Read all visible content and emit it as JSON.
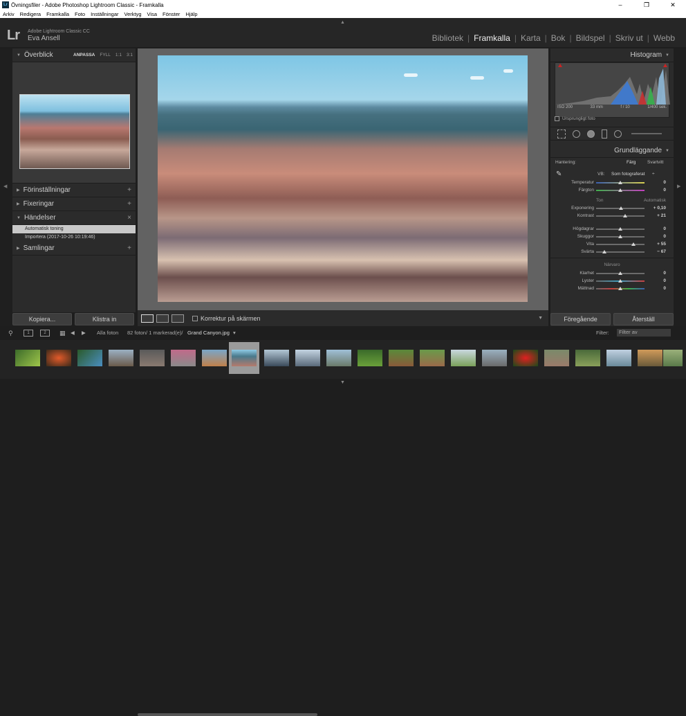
{
  "window": {
    "title": "Övningsfiler - Adobe Photoshop Lightroom Classic - Framkalla",
    "app_icon": "Lr"
  },
  "menu": [
    "Arkiv",
    "Redigera",
    "Framkalla",
    "Foto",
    "Inställningar",
    "Verktyg",
    "Visa",
    "Fönster",
    "Hjälp"
  ],
  "identity": {
    "logo": "Lr",
    "app_name": "Adobe Lightroom Classic CC",
    "user": "Eva Ansell"
  },
  "modules": [
    "Bibliotek",
    "Framkalla",
    "Karta",
    "Bok",
    "Bildspel",
    "Skriv ut",
    "Webb"
  ],
  "left_panel": {
    "navigator": {
      "title": "Överblick",
      "zooms": [
        "ANPASSA",
        "FYLL",
        "1:1",
        "3:1"
      ]
    },
    "presets": "Förinställningar",
    "snapshots": "Fixeringar",
    "history": {
      "title": "Händelser",
      "items": [
        "Automatisk toning",
        "Importera (2017-10-26 10:19:46)"
      ]
    },
    "collections": "Samlingar",
    "copy_btn": "Kopiera...",
    "paste_btn": "Klistra in"
  },
  "toolbar": {
    "proof_label": "Korrektur på skärmen"
  },
  "right_panel": {
    "histogram_title": "Histogram",
    "info": [
      "ISO 200",
      "33 mm",
      "f / 10",
      "1/400 sek."
    ],
    "original_photo": "Ursprungligt foto",
    "basic_title": "Grundläggande",
    "treatment_label": "Hantering:",
    "treatment_color": "Färg",
    "treatment_bw": "Svartvitt",
    "wb_label": "VB:",
    "wb_value": "Som fotograferat",
    "temperature": {
      "label": "Temperatur",
      "value": "0",
      "pos": 0.5
    },
    "tint": {
      "label": "Färgton",
      "value": "0",
      "pos": 0.5
    },
    "tone_title": "Ton",
    "tone_auto": "Automatisk",
    "exposure": {
      "label": "Exponering",
      "value": "+ 0,10",
      "pos": 0.51
    },
    "contrast": {
      "label": "Kontrast",
      "value": "+ 21",
      "pos": 0.6
    },
    "highlights": {
      "label": "Högdagrar",
      "value": "0",
      "pos": 0.5
    },
    "shadows": {
      "label": "Skuggor",
      "value": "0",
      "pos": 0.5
    },
    "whites": {
      "label": "Vita",
      "value": "+ 55",
      "pos": 0.77
    },
    "blacks": {
      "label": "Svärta",
      "value": "− 67",
      "pos": 0.17
    },
    "presence_title": "Närvaro",
    "clarity": {
      "label": "Klarhet",
      "value": "0",
      "pos": 0.5
    },
    "vibrance": {
      "label": "Lyster",
      "value": "0",
      "pos": 0.5
    },
    "saturation": {
      "label": "Mättnad",
      "value": "0",
      "pos": 0.5
    },
    "prev_btn": "Föregående",
    "reset_btn": "Återställ"
  },
  "filmbar": {
    "page1": "1",
    "page2": "2",
    "source": "Alla foton",
    "count": "82 foton/ 1 markerad(e)/",
    "filename": "Grand Canyon.jpg",
    "filter_label": "Filter:",
    "filter_value": "Filter av"
  },
  "colors": {
    "panel": "#2b2b2b",
    "bg": "#1e1e1e",
    "center": "#626262",
    "active_module": "#f0f0f0"
  }
}
